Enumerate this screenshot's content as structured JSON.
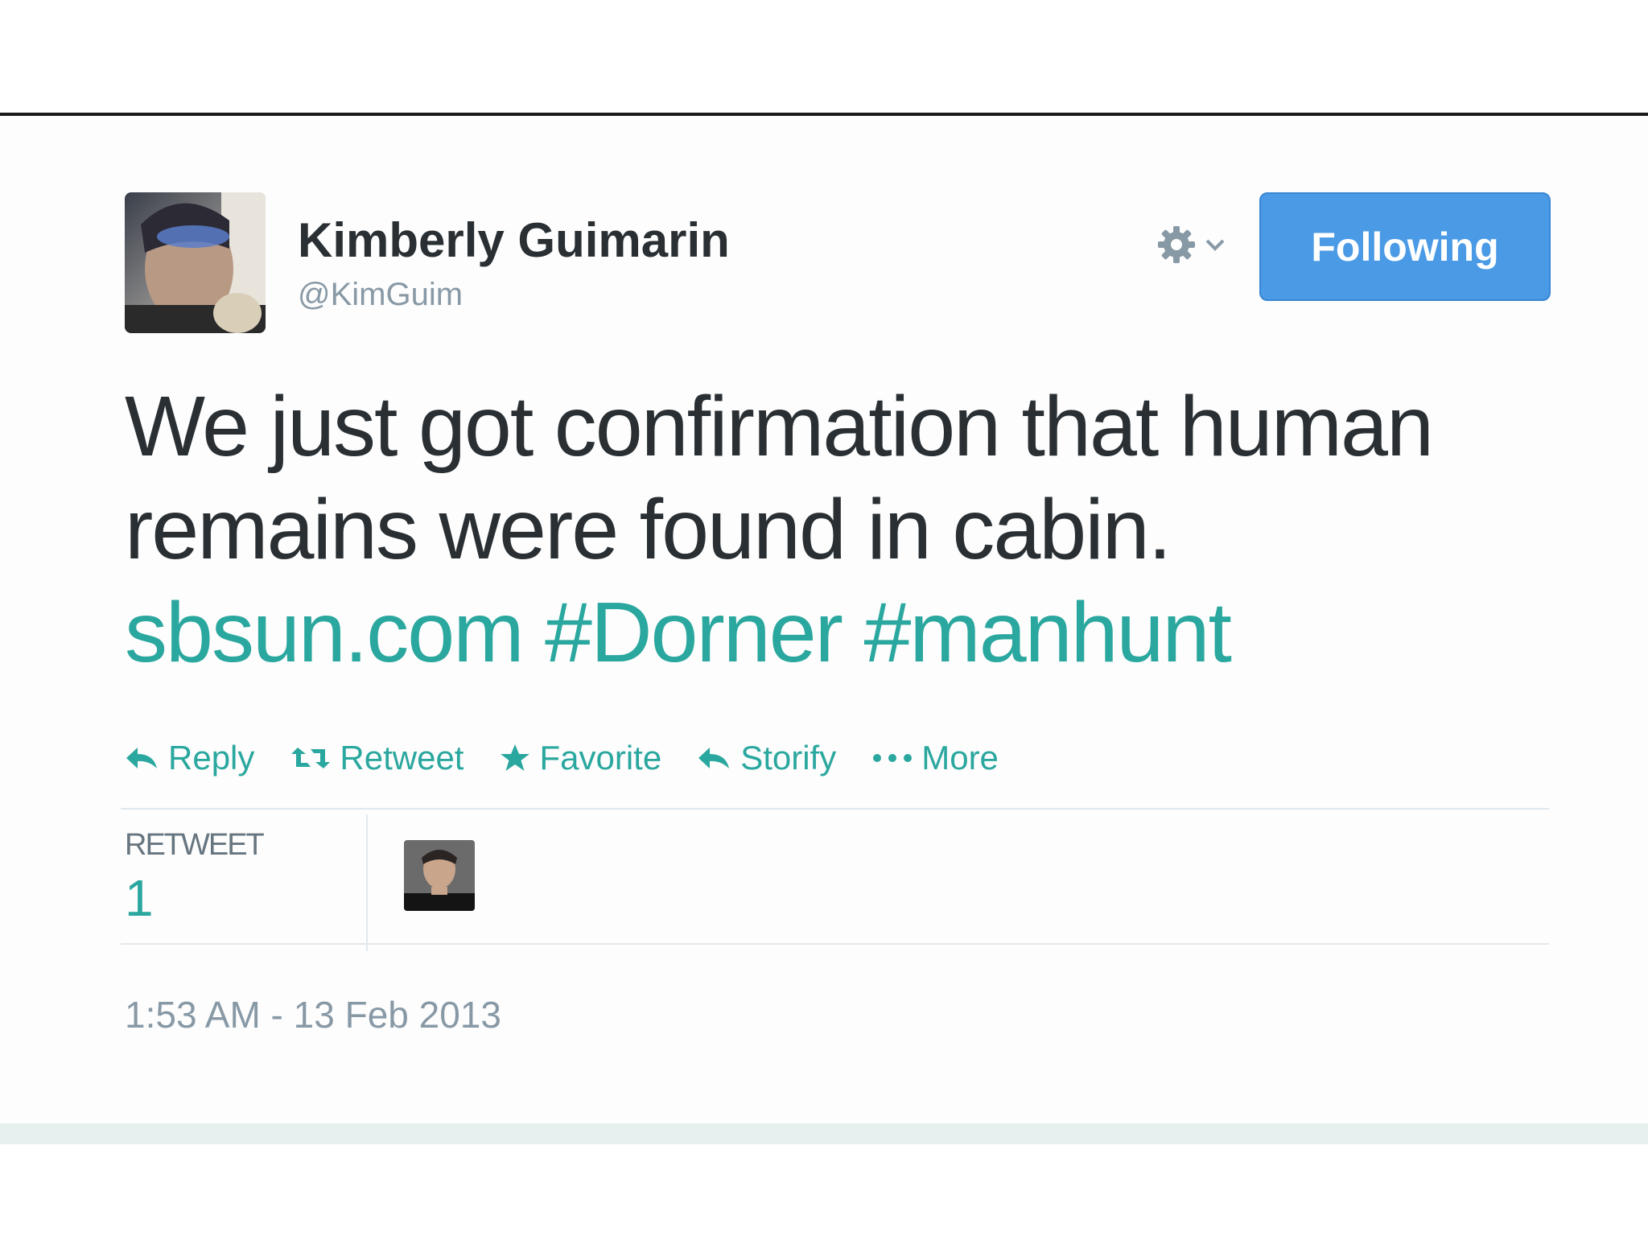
{
  "user": {
    "display_name": "Kimberly Guimarin",
    "screen_name": "@KimGuim"
  },
  "follow_button": {
    "label": "Following"
  },
  "tweet": {
    "text_line1": "We just got confirmation that human",
    "text_line2": "remains were found in cabin.",
    "link": "sbsun.com",
    "hashtag1": "#Dorner",
    "hashtag2": "#manhunt"
  },
  "actions": {
    "reply": "Reply",
    "retweet": "Retweet",
    "favorite": "Favorite",
    "storify": "Storify",
    "more": "More"
  },
  "stats": {
    "retweet_label": "RETWEET",
    "retweet_count": "1"
  },
  "timestamp": "1:53 AM - 13 Feb 2013",
  "icons": {
    "settings": "gear-icon",
    "dropdown": "chevron-down-icon",
    "reply": "reply-icon",
    "retweet": "retweet-icon",
    "favorite": "star-icon",
    "storify": "storify-icon",
    "more": "more-icon"
  },
  "colors": {
    "link": "#2aa79e",
    "follow_button": "#4a9ae6",
    "text": "#292f33",
    "muted": "#8899a6"
  }
}
